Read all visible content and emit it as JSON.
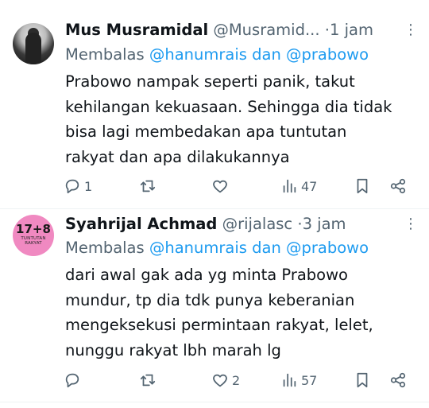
{
  "tweets": [
    {
      "name": "Mus Musramidal",
      "handle": "@Musramid...",
      "separator": "·",
      "time": "1 jam",
      "reply_prefix": "Membalas",
      "reply_to": "@hanumrais dan @prabowo",
      "text_lines": [
        "Prabowo nampak seperti panik, takut",
        "kehilangan kekuasaan. Sehingga dia tidak",
        "bisa lagi membedakan apa tuntutan",
        "rakyat dan apa dilakukannya"
      ],
      "stats": {
        "replies": "1",
        "retweets": "",
        "likes": "",
        "views": "47"
      }
    },
    {
      "name": "Syahrijal Achmad",
      "handle": "@rijalasc",
      "separator": "·",
      "time": "3 jam",
      "reply_prefix": "Membalas",
      "reply_to": "@hanumrais dan @prabowo",
      "avatar_text": "17+8",
      "avatar_subtext": "TUNTUTAN RAKYAT",
      "text_lines": [
        "dari awal gak ada yg minta Prabowo",
        "mundur, tp dia tdk punya keberanian",
        "mengeksekusi permintaan rakyat, lelet,",
        "nunggu rakyat lbh marah lg"
      ],
      "stats": {
        "replies": "",
        "retweets": "",
        "likes": "2",
        "views": "57"
      }
    }
  ],
  "icons": {
    "reply": "reply-icon",
    "retweet": "retweet-icon",
    "like": "heart-icon",
    "views": "views-icon",
    "bookmark": "bookmark-icon",
    "share": "share-icon",
    "more": "more-icon"
  },
  "colors": {
    "link": "#1d9bf0",
    "secondary": "#536471",
    "text": "#0f1419",
    "avatar_bg": "#f089c1"
  }
}
